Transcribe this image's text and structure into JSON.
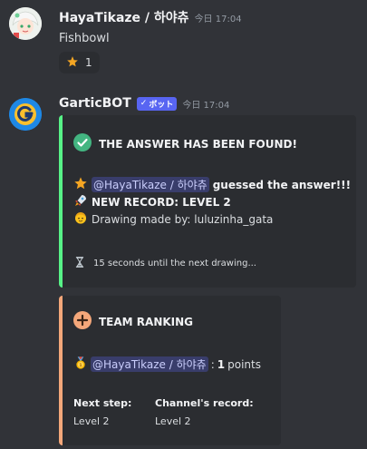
{
  "message1": {
    "username": "HayaTikaze / 하야츄",
    "timestamp": "今日 17:04",
    "text": "Fishbowl",
    "reaction": {
      "emoji": "star",
      "count": "1"
    }
  },
  "message2": {
    "username": "GarticBOT",
    "bot_tag": "ボット",
    "timestamp": "今日 17:04",
    "embed1": {
      "accent_color": "#57f287",
      "title": "THE ANSWER HAS BEEN FOUND!",
      "mention": "@HayaTikaze / 하야츄",
      "guessed_text": "guessed the answer!!!",
      "record_text": "NEW RECORD: LEVEL 2",
      "drawing_text": "Drawing made by: luluzinha_gata",
      "next_text": "15 seconds until the next drawing..."
    },
    "embed2": {
      "accent_color": "#f4a77a",
      "title": "TEAM RANKING",
      "mention": "@HayaTikaze / 하야츄",
      "points_value": "1",
      "points_label": "points",
      "colon": ":",
      "field1_name": "Next step:",
      "field1_value": "Level 2",
      "field2_name": "Channel's record:",
      "field2_value": "Level 2"
    }
  }
}
